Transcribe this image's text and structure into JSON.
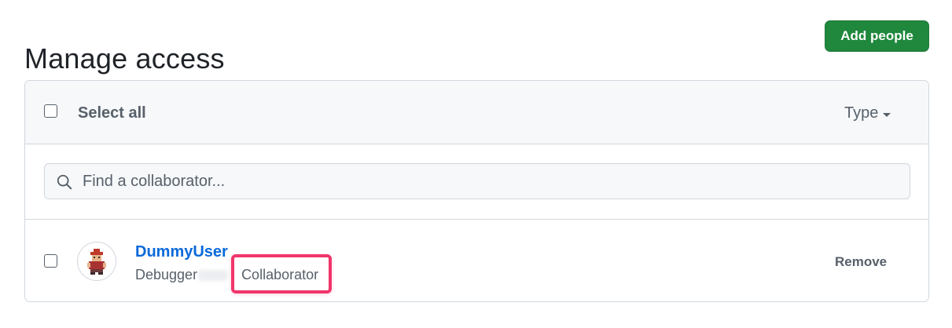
{
  "page": {
    "title": "Manage access"
  },
  "toolbar": {
    "add_people_label": "Add people",
    "accent_color": "#1f883d"
  },
  "list_header": {
    "select_all_label": "Select all",
    "type_filter_label": "Type"
  },
  "search": {
    "placeholder": "Find a collaborator...",
    "value": "",
    "icon": "search-icon"
  },
  "members": [
    {
      "username": "DummyUser",
      "display_name": "Debugger",
      "role": "Collaborator",
      "remove_label": "Remove",
      "avatar_icon": "pixel-avatar"
    }
  ],
  "annotation": {
    "highlight_color": "#f0356b"
  }
}
